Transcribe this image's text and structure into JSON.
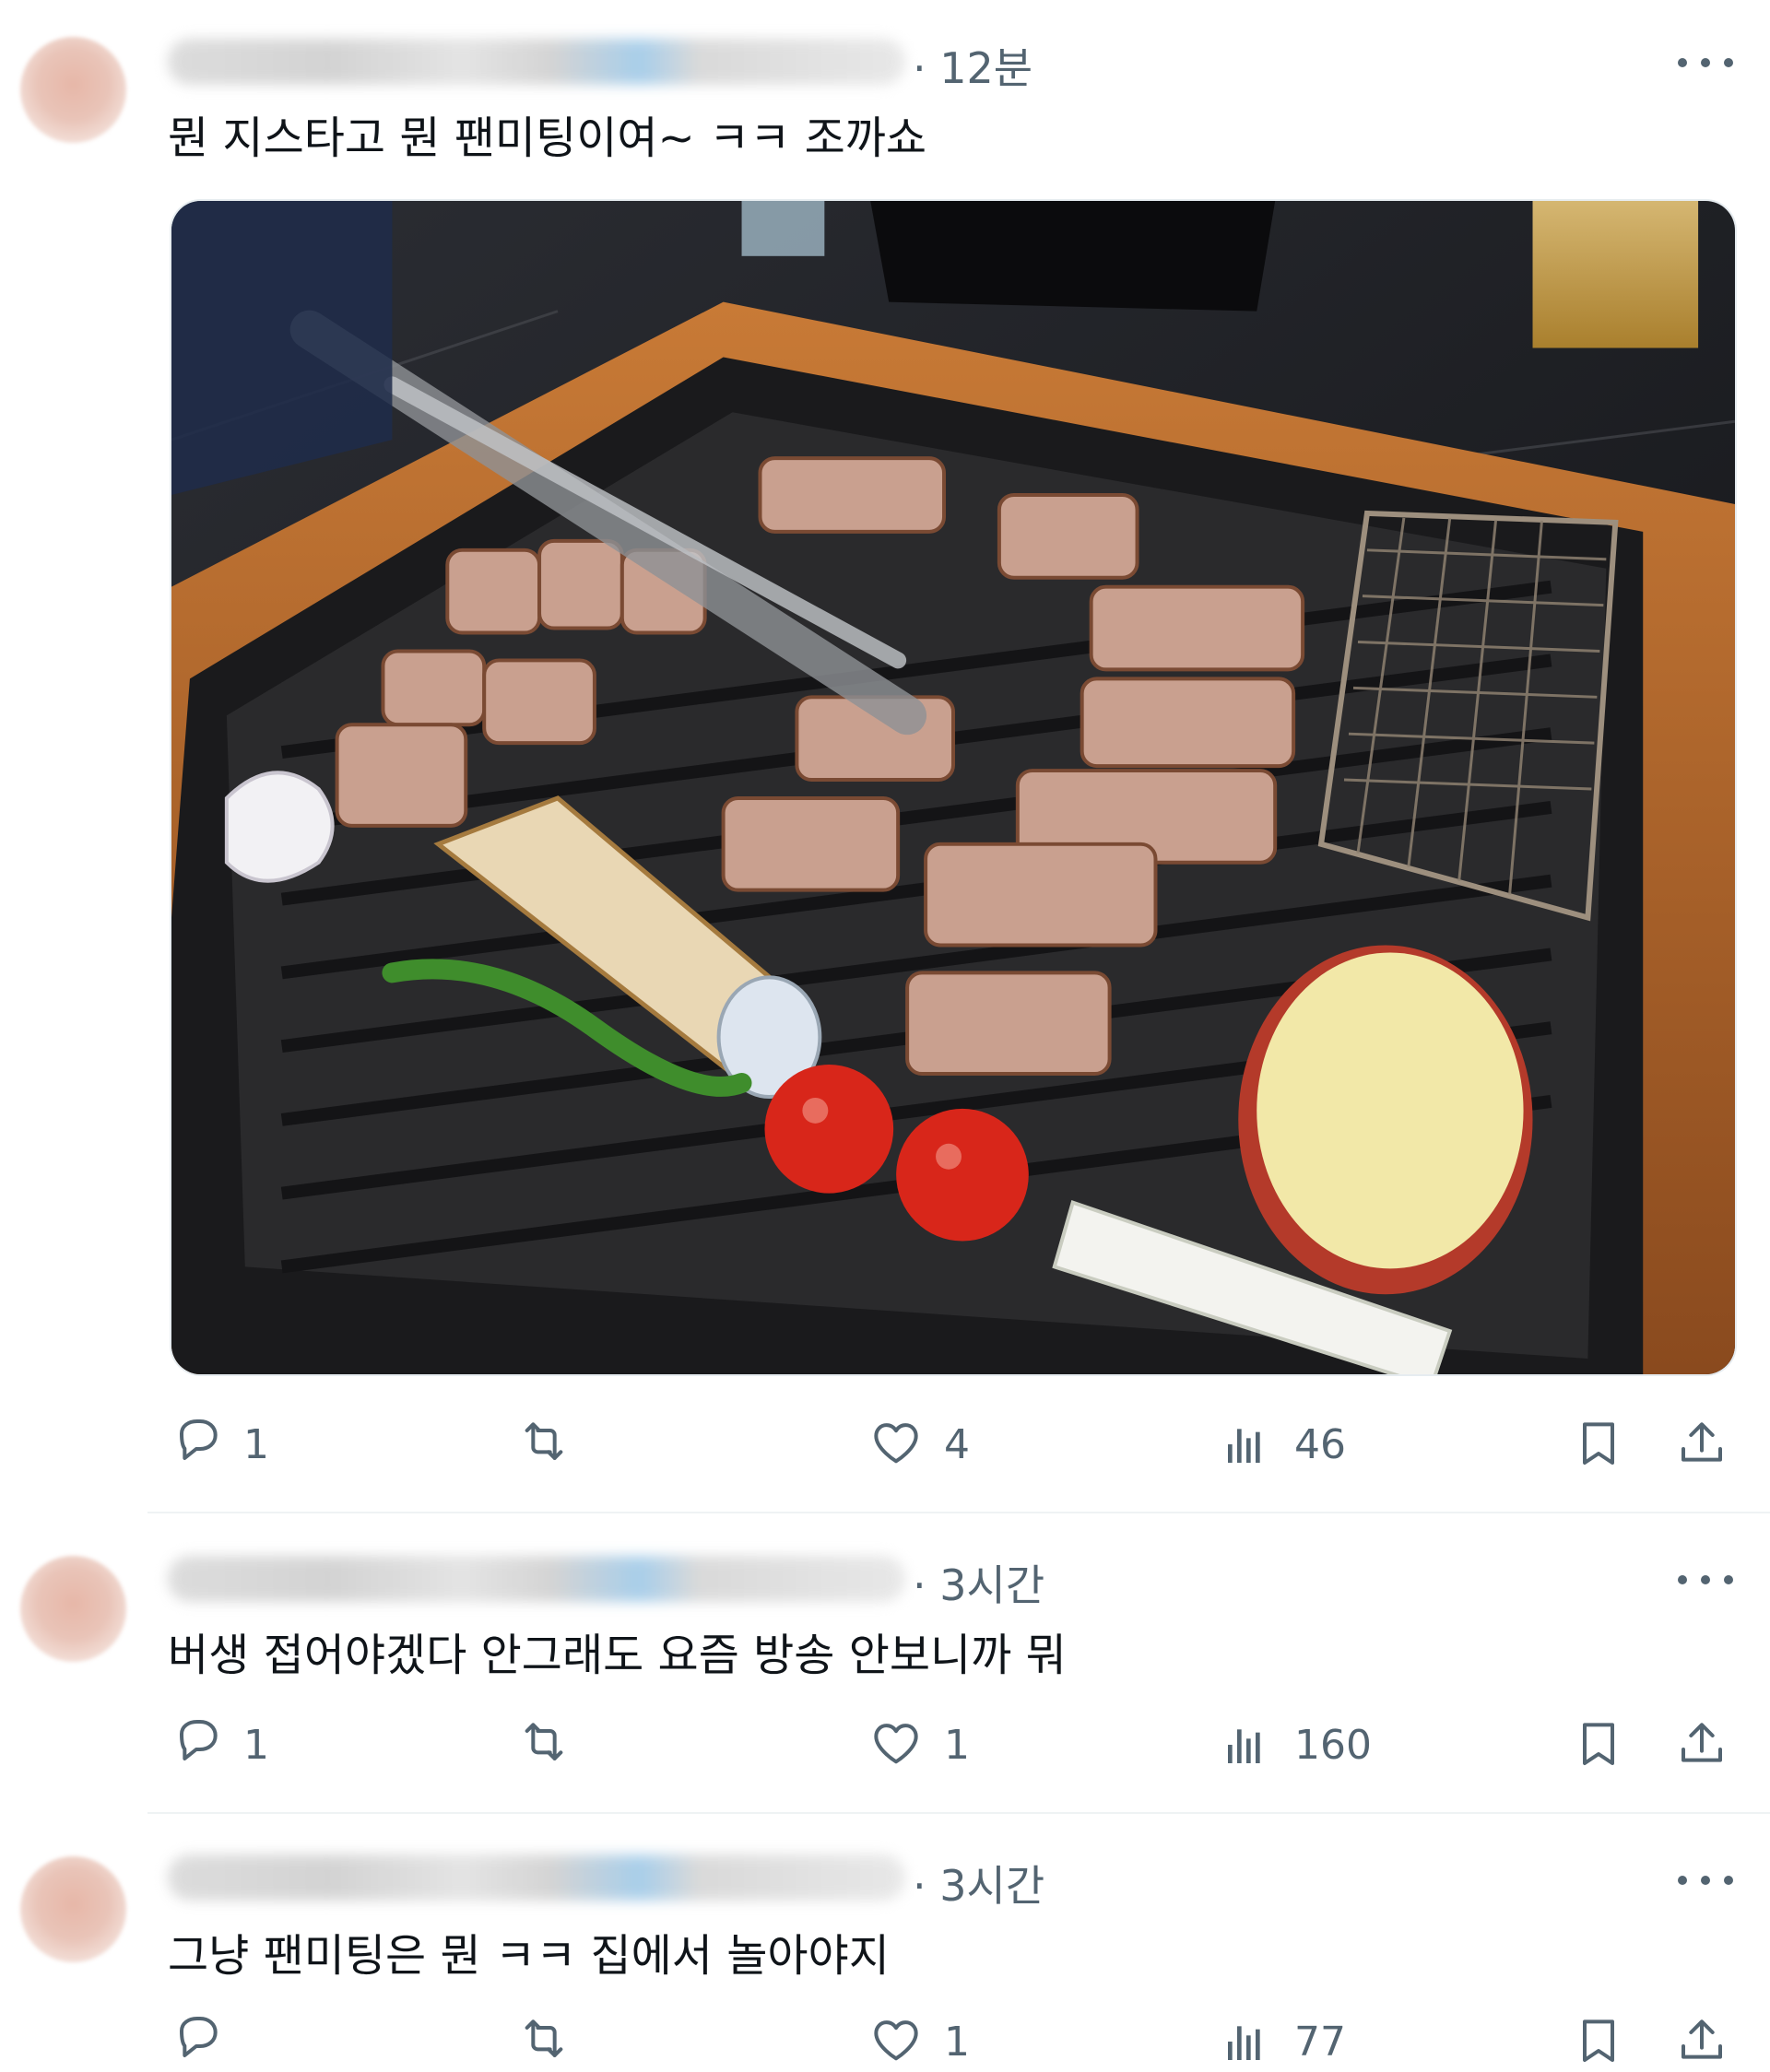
{
  "posts": [
    {
      "time": "· 12분",
      "text": "뭔 지스타고 뭔 팬미팅이여~ ㅋㅋ 조까쇼",
      "reply_count": "1",
      "like_count": "4",
      "view_count": "46"
    },
    {
      "time": "· 3시간",
      "text": "버생 접어야겠다 안그래도 요즘 방송 안보니까 뭐",
      "reply_count": "1",
      "like_count": "1",
      "view_count": "160"
    },
    {
      "time": "· 3시간",
      "text": "그냥 팬미팅은 뭔 ㅋㅋ 집에서 놀아야지",
      "reply_count": "",
      "like_count": "1",
      "view_count": "77"
    }
  ],
  "icons": {
    "reply": "reply-icon",
    "repost": "repost-icon",
    "like": "heart-icon",
    "views": "views-icon",
    "bookmark": "bookmark-icon",
    "share": "share-icon",
    "more": "more-icon"
  },
  "colors": {
    "text": "#0f1419",
    "muted": "#536471",
    "divider": "#eff3f4"
  }
}
